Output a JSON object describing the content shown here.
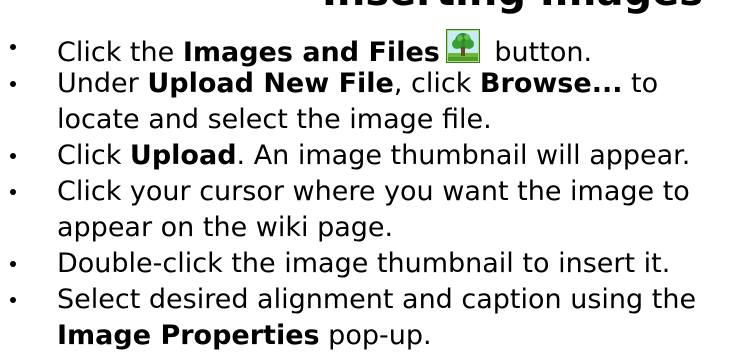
{
  "heading": "Inserting Images",
  "icons": {
    "images_and_files": "tree-image-icon"
  },
  "instructions": [
    {
      "t1": "Click the ",
      "b1": "Images and Files",
      "t2": " button."
    },
    {
      "t1": "Under ",
      "b1": "Upload New File",
      "t2": ", click ",
      "b2": "Browse...",
      "t3": " to",
      "line2": "locate and select the image file."
    },
    {
      "t1": "Click ",
      "b1": "Upload",
      "t2": ". An image thumbnail will appear."
    },
    {
      "t1": "Click your cursor where you want the image to",
      "line2": "appear on the wiki page."
    },
    {
      "t1": "Double-click the image thumbnail to insert it."
    },
    {
      "t1": "Select desired alignment and caption using the",
      "b2": "Image Properties",
      "t3": " pop-up."
    }
  ]
}
